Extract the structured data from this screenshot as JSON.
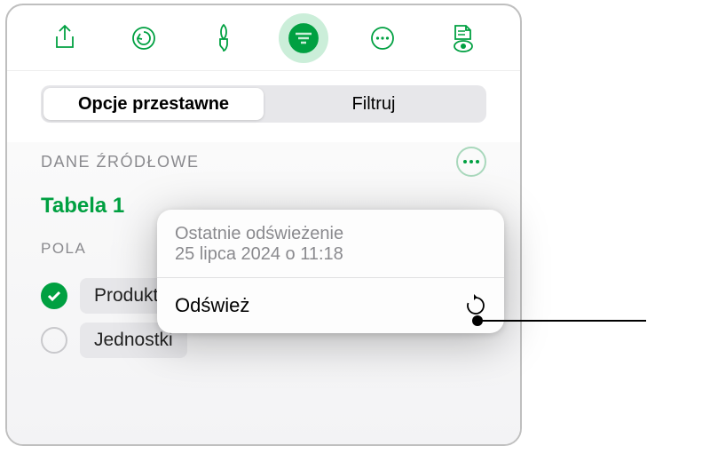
{
  "segmented": {
    "opt1": "Opcje przestawne",
    "opt2": "Filtruj"
  },
  "sourceSection": "DANE ŹRÓDŁOWE",
  "tableName": "Tabela 1",
  "fieldsSection": "POLA",
  "fields": [
    {
      "label": "Produkt",
      "checked": true
    },
    {
      "label": "Jednostki",
      "checked": false
    }
  ],
  "popover": {
    "lastRefreshLabel": "Ostatnie odświeżenie",
    "lastRefreshValue": "25 lipca 2024 o 11:18",
    "refreshLabel": "Odśwież"
  }
}
